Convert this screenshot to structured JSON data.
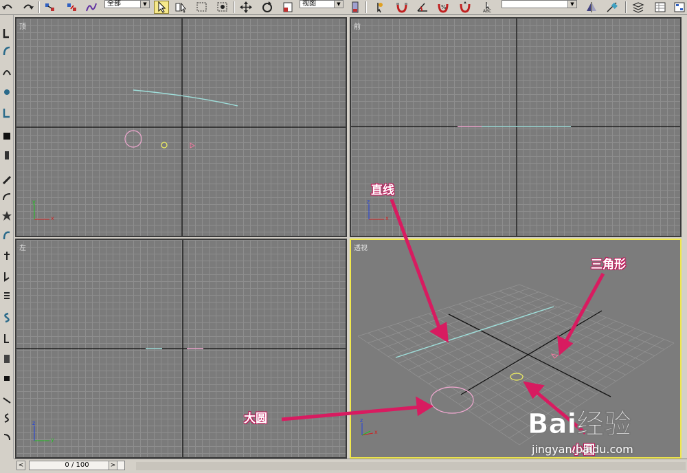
{
  "toolbar": {
    "selection_filter": "全部",
    "reference_coord": "视图",
    "named_selection": ""
  },
  "viewports": {
    "top": {
      "label": "顶"
    },
    "front": {
      "label": "前"
    },
    "left": {
      "label": "左"
    },
    "perspective": {
      "label": "透视",
      "active": true
    }
  },
  "axes": {
    "x": "x",
    "y": "y",
    "z": "z"
  },
  "timeline": {
    "frame_display": "0 / 100",
    "prev": "<",
    "next": ">"
  },
  "annotations": {
    "line": "直线",
    "triangle": "三角形",
    "big_circle": "大圆",
    "small_circle": "小圆"
  },
  "watermark": {
    "brand": "Bai经验",
    "url": "jingyan.baidu.com"
  },
  "colors": {
    "line_shape": "#9fe0dc",
    "big_circle": "#f0a8d0",
    "small_circle": "#f0f060",
    "triangle": "#f07aa0",
    "active_border": "#f0e84c",
    "annotation_arrow": "#d81b60"
  }
}
